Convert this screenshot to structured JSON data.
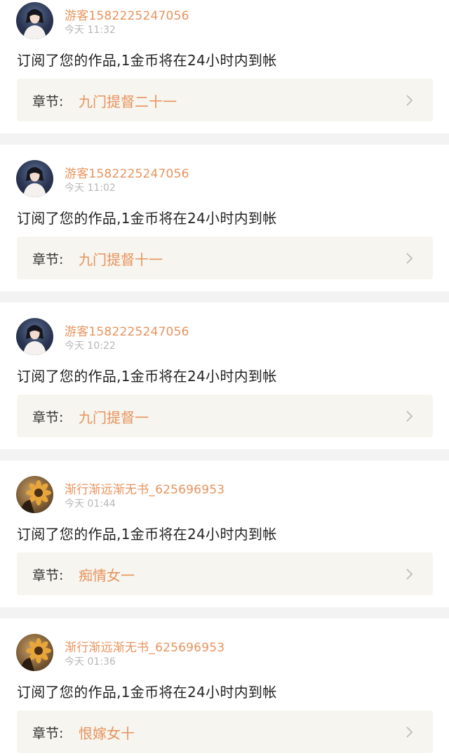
{
  "colors": {
    "accent": "#e8935d",
    "text": "#222222",
    "muted": "#b7b7b7",
    "chapter_bg": "#f6f5ef",
    "page_bg": "#f3f3f3"
  },
  "icons": {
    "chapter_arrow": "chevron-right-icon"
  },
  "notifications": [
    {
      "avatar": "guest-avatar",
      "username": "游客1582225247056",
      "time": "今天 11:32",
      "message": "订阅了您的作品,1金币将在24小时内到帐",
      "chapter_prefix": "章节:",
      "chapter_title": "九门提督二十一"
    },
    {
      "avatar": "guest-avatar",
      "username": "游客1582225247056",
      "time": "今天 11:02",
      "message": "订阅了您的作品,1金币将在24小时内到帐",
      "chapter_prefix": "章节:",
      "chapter_title": "九门提督十一"
    },
    {
      "avatar": "guest-avatar",
      "username": "游客1582225247056",
      "time": "今天 10:22",
      "message": "订阅了您的作品,1金币将在24小时内到帐",
      "chapter_prefix": "章节:",
      "chapter_title": "九门提督一"
    },
    {
      "avatar": "sunflower-avatar",
      "username": "渐行渐远渐无书_625696953",
      "time": "今天 01:44",
      "message": "订阅了您的作品,1金币将在24小时内到帐",
      "chapter_prefix": "章节:",
      "chapter_title": "痴情女一"
    },
    {
      "avatar": "sunflower-avatar",
      "username": "渐行渐远渐无书_625696953",
      "time": "今天 01:36",
      "message": "订阅了您的作品,1金币将在24小时内到帐",
      "chapter_prefix": "章节:",
      "chapter_title": "恨嫁女十"
    }
  ]
}
